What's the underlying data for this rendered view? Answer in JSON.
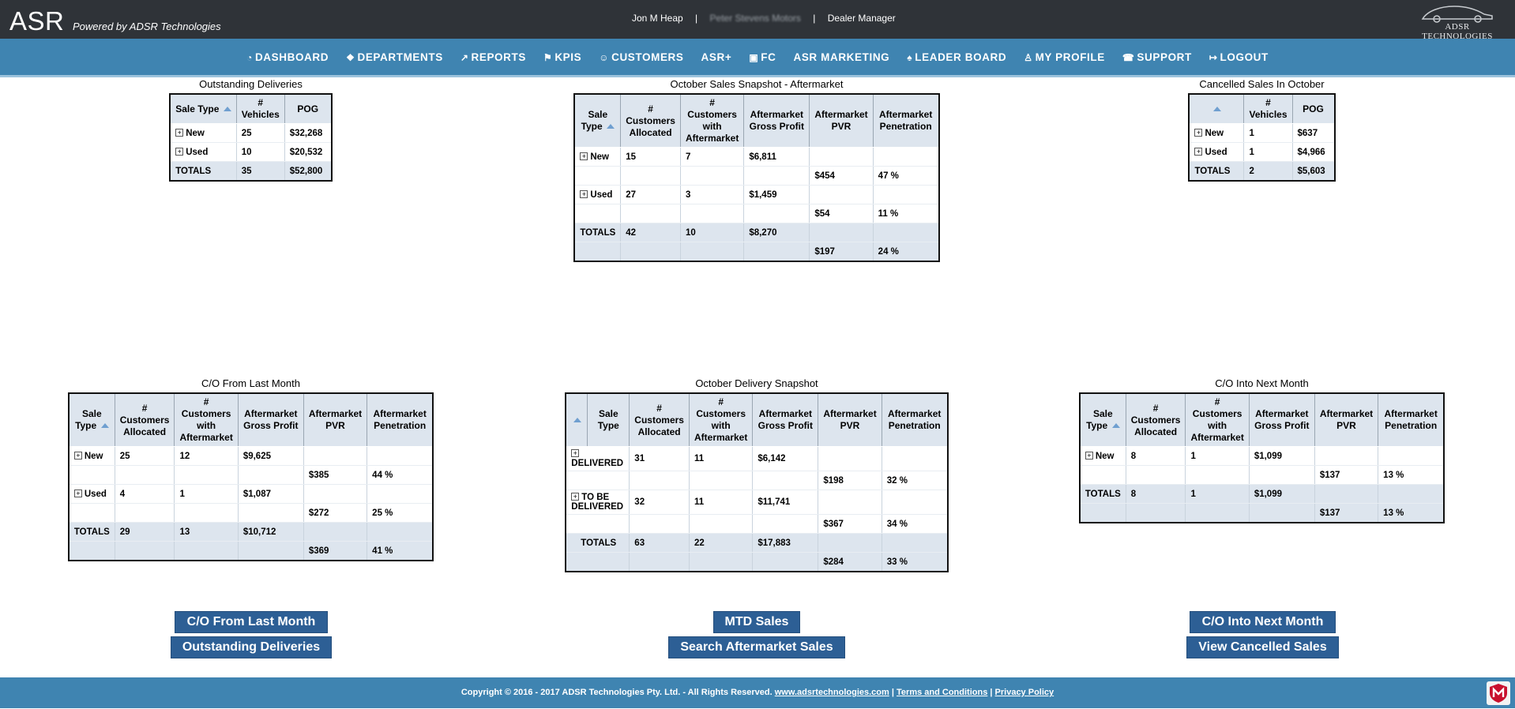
{
  "header": {
    "logo": "ASR",
    "tagline": "Powered by ADSR Technologies",
    "user_name": "Jon M Heap",
    "dealer_name": "Peter Stevens Motors",
    "role": "Dealer Manager",
    "brand": "ADSR TECHNOLOGIES"
  },
  "nav": [
    {
      "label": "DASHBOARD",
      "icon": "dashboard-icon"
    },
    {
      "label": "DEPARTMENTS",
      "icon": "cubes-icon"
    },
    {
      "label": "REPORTS",
      "icon": "line-chart-icon"
    },
    {
      "label": "KPIS",
      "icon": "flag-icon"
    },
    {
      "label": "CUSTOMERS",
      "icon": "users-icon"
    },
    {
      "label": "ASR+",
      "icon": ""
    },
    {
      "label": "FC",
      "icon": "money-icon"
    },
    {
      "label": "ASR MARKETING",
      "icon": ""
    },
    {
      "label": "LEADER BOARD",
      "icon": "trophy-icon"
    },
    {
      "label": "MY PROFILE",
      "icon": "user-icon"
    },
    {
      "label": "SUPPORT",
      "icon": "phone-icon"
    },
    {
      "label": "LOGOUT",
      "icon": "sign-out-icon"
    }
  ],
  "outstanding": {
    "title": "Outstanding Deliveries",
    "headers": [
      "Sale Type",
      "# Vehicles",
      "POG"
    ],
    "rows": [
      [
        "New",
        "25",
        "$32,268"
      ],
      [
        "Used",
        "10",
        "$20,532"
      ]
    ],
    "totals": [
      "TOTALS",
      "35",
      "$52,800"
    ]
  },
  "sales_snapshot": {
    "title": "October Sales Snapshot - Aftermarket",
    "headers": [
      "Sale Type",
      "# Customers Allocated",
      "# Customers with Aftermarket",
      "Aftermarket Gross Profit",
      "Aftermarket PVR",
      "Aftermarket Penetration"
    ],
    "rows": [
      {
        "type": "New",
        "alloc": "15",
        "with": "7",
        "gross": "$6,811",
        "pvr": "$454",
        "pen": "47 %"
      },
      {
        "type": "Used",
        "alloc": "27",
        "with": "3",
        "gross": "$1,459",
        "pvr": "$54",
        "pen": "11 %"
      }
    ],
    "totals": {
      "type": "TOTALS",
      "alloc": "42",
      "with": "10",
      "gross": "$8,270",
      "pvr": "$197",
      "pen": "24 %"
    }
  },
  "cancelled": {
    "title": "Cancelled Sales In October",
    "headers": [
      "",
      "# Vehicles",
      "POG"
    ],
    "rows": [
      [
        "New",
        "1",
        "$637"
      ],
      [
        "Used",
        "1",
        "$4,966"
      ]
    ],
    "totals": [
      "TOTALS",
      "2",
      "$5,603"
    ]
  },
  "co_last": {
    "title": "C/O From Last Month",
    "headers": [
      "Sale Type",
      "# Customers Allocated",
      "# Customers with Aftermarket",
      "Aftermarket Gross Profit",
      "Aftermarket PVR",
      "Aftermarket Penetration"
    ],
    "rows": [
      {
        "type": "New",
        "alloc": "25",
        "with": "12",
        "gross": "$9,625",
        "pvr": "$385",
        "pen": "44 %"
      },
      {
        "type": "Used",
        "alloc": "4",
        "with": "1",
        "gross": "$1,087",
        "pvr": "$272",
        "pen": "25 %"
      }
    ],
    "totals": {
      "type": "TOTALS",
      "alloc": "29",
      "with": "13",
      "gross": "$10,712",
      "pvr": "$369",
      "pen": "41 %"
    }
  },
  "delivery": {
    "title": "October Delivery Snapshot",
    "headers": [
      "",
      "Sale Type",
      "# Customers Allocated",
      "# Customers with Aftermarket",
      "Aftermarket Gross Profit",
      "Aftermarket PVR",
      "Aftermarket Penetration"
    ],
    "rows": [
      {
        "type": "DELIVERED",
        "alloc": "31",
        "with": "11",
        "gross": "$6,142",
        "pvr": "$198",
        "pen": "32 %"
      },
      {
        "type": "TO BE DELIVERED",
        "alloc": "32",
        "with": "11",
        "gross": "$11,741",
        "pvr": "$367",
        "pen": "34 %"
      }
    ],
    "totals": {
      "type": "TOTALS",
      "alloc": "63",
      "with": "22",
      "gross": "$17,883",
      "pvr": "$284",
      "pen": "33 %"
    }
  },
  "co_next": {
    "title": "C/O Into Next Month",
    "headers": [
      "Sale Type",
      "# Customers Allocated",
      "# Customers with Aftermarket",
      "Aftermarket Gross Profit",
      "Aftermarket PVR",
      "Aftermarket Penetration"
    ],
    "rows": [
      {
        "type": "New",
        "alloc": "8",
        "with": "1",
        "gross": "$1,099",
        "pvr": "$137",
        "pen": "13 %"
      }
    ],
    "totals": {
      "type": "TOTALS",
      "alloc": "8",
      "with": "1",
      "gross": "$1,099",
      "pvr": "$137",
      "pen": "13 %"
    }
  },
  "buttons": {
    "co_last": "C/O From Last Month",
    "outstanding": "Outstanding Deliveries",
    "mtd": "MTD Sales",
    "search": "Search Aftermarket Sales",
    "co_next": "C/O Into Next Month",
    "cancelled": "View Cancelled Sales"
  },
  "footer": {
    "copyright": "Copyright © 2016 - 2017 ADSR Technologies Pty. Ltd. - All Rights Reserved.",
    "site": "www.adsrtechnologies.com",
    "terms": "Terms and Conditions",
    "privacy": "Privacy Policy"
  }
}
